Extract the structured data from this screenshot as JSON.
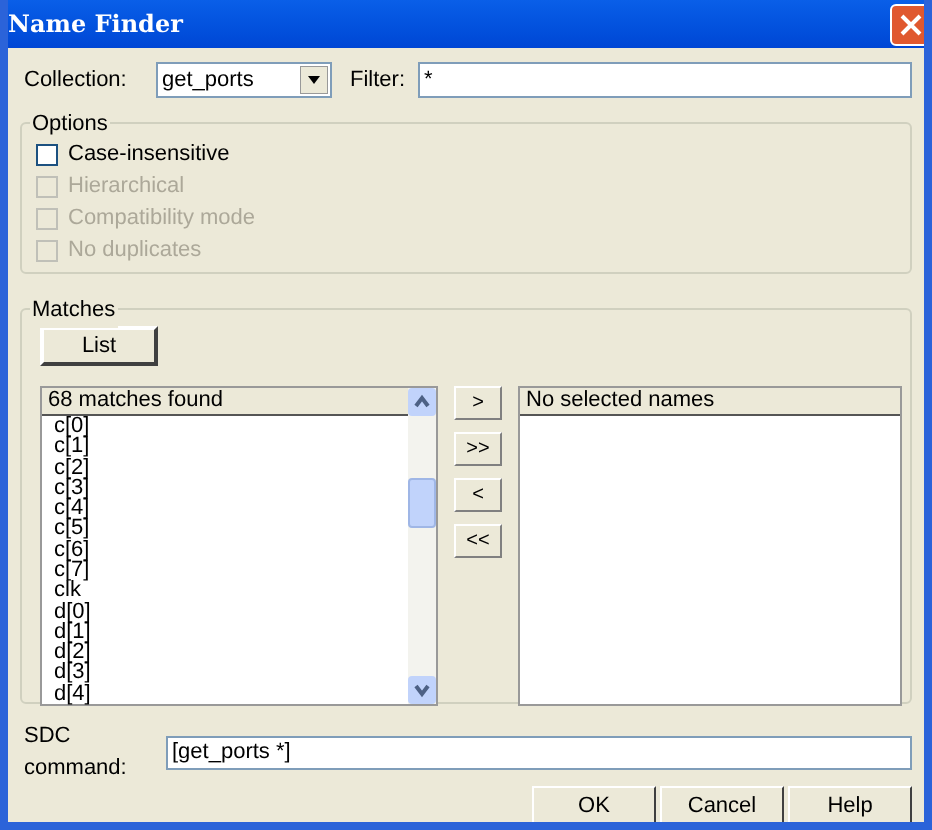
{
  "window": {
    "title": "Name Finder"
  },
  "collection": {
    "label": "Collection:",
    "value": "get_ports"
  },
  "filter": {
    "label": "Filter:",
    "value": "*"
  },
  "options": {
    "title": "Options",
    "items": [
      {
        "label": "Case-insensitive",
        "checked": false,
        "disabled": false
      },
      {
        "label": "Hierarchical",
        "checked": false,
        "disabled": true
      },
      {
        "label": "Compatibility mode",
        "checked": false,
        "disabled": true
      },
      {
        "label": "No duplicates",
        "checked": false,
        "disabled": true
      }
    ]
  },
  "matches": {
    "title": "Matches",
    "list_button": "List",
    "found_list": {
      "header": "68 matches found",
      "items": [
        "c[0]",
        "c[1]",
        "c[2]",
        "c[3]",
        "c[4]",
        "c[5]",
        "c[6]",
        "c[7]",
        "clk",
        "d[0]",
        "d[1]",
        "d[2]",
        "d[3]",
        "d[4]"
      ]
    },
    "move_buttons": [
      ">",
      ">>",
      "<",
      "<<"
    ],
    "selected_list": {
      "header": "No selected names"
    }
  },
  "sdc_command": {
    "label": "SDC command:",
    "value": "[get_ports *]"
  },
  "buttons": [
    "OK",
    "Cancel",
    "Help"
  ]
}
